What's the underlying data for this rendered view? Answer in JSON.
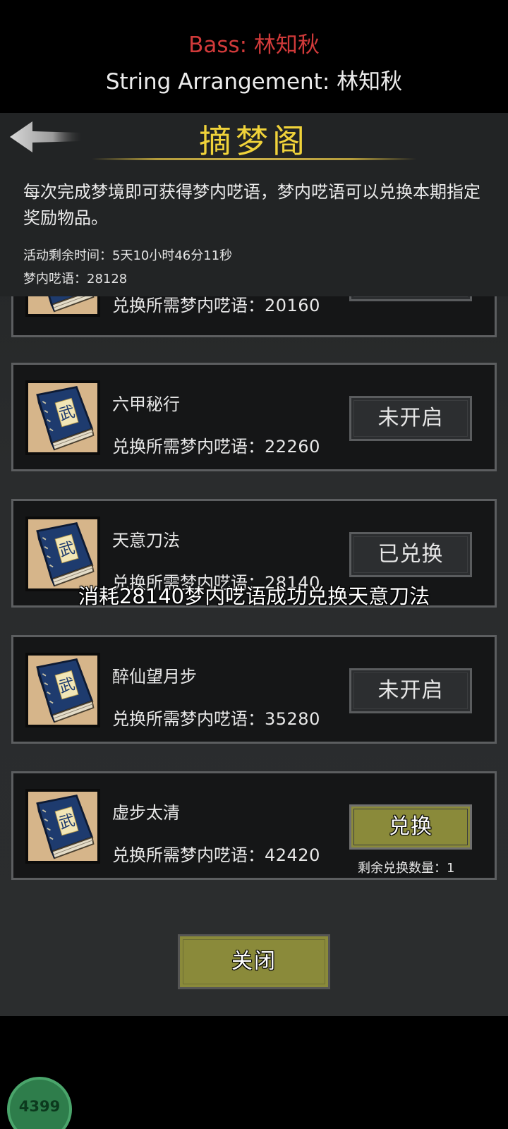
{
  "credits": {
    "bass_label": "Bass: 林知秋",
    "bass_tail": "",
    "string_label": "String Arrangement: 林知秋"
  },
  "header": {
    "title": "摘梦阁",
    "description": "每次完成梦境即可获得梦内呓语，梦内呓语可以兑换本期指定奖励物品。",
    "timer_label": "活动剩余时间：",
    "timer_value": "5天10小时46分11秒",
    "points_label": "梦内呓语：",
    "points_value": "28128"
  },
  "cost_label": "兑换所需梦内呓语：",
  "items": [
    {
      "name": "",
      "cost": "20160",
      "button": ""
    },
    {
      "name": "六甲秘行",
      "cost": "22260",
      "button": "未开启"
    },
    {
      "name": "天意刀法",
      "cost": "28140",
      "button": "已兑换"
    },
    {
      "name": "醉仙望月步",
      "cost": "35280",
      "button": "未开启"
    },
    {
      "name": "虚步太清",
      "cost": "42420",
      "button": "兑换",
      "remaining": "剩余兑换数量：1"
    }
  ],
  "toast": "消耗28140梦内呓语成功兑换天意刀法",
  "close_button": "关闭",
  "badge_value": "4399",
  "icons": {
    "back": "back-arrow-icon",
    "book": "martial-book-icon"
  },
  "colors": {
    "title": "#f0d33a",
    "bass": "#d13a3a",
    "active_button": "#8a8a3a"
  }
}
